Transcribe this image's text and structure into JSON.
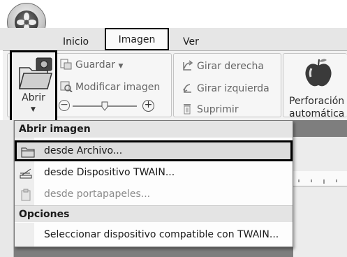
{
  "tabs": {
    "inicio": "Inicio",
    "imagen": "Imagen",
    "ver": "Ver"
  },
  "ribbon": {
    "abrir_label": "Abrir",
    "guardar_label": "Guardar",
    "modificar_label": "Modificar imagen",
    "girar_derecha_label": "Girar derecha",
    "girar_izquierda_label": "Girar izquierda",
    "suprimir_label": "Suprimir",
    "perforacion_line1": "Perforación",
    "perforacion_line2": "automática"
  },
  "menu": {
    "header_abrir": "Abrir imagen",
    "items": [
      {
        "label": "desde Archivo...",
        "icon": "folder-icon",
        "enabled": true
      },
      {
        "label": "desde Dispositivo TWAIN...",
        "icon": "scanner-icon",
        "enabled": true
      },
      {
        "label": "desde portapapeles...",
        "icon": "clipboard-icon",
        "enabled": false
      }
    ],
    "header_opciones": "Opciones",
    "opciones_item": "Seleccionar dispositivo compatible con TWAIN..."
  },
  "colors": {
    "highlight_border": "#000000",
    "menu_header_bg": "#e4e4e4",
    "workarea_bg": "#7e7e7e"
  }
}
